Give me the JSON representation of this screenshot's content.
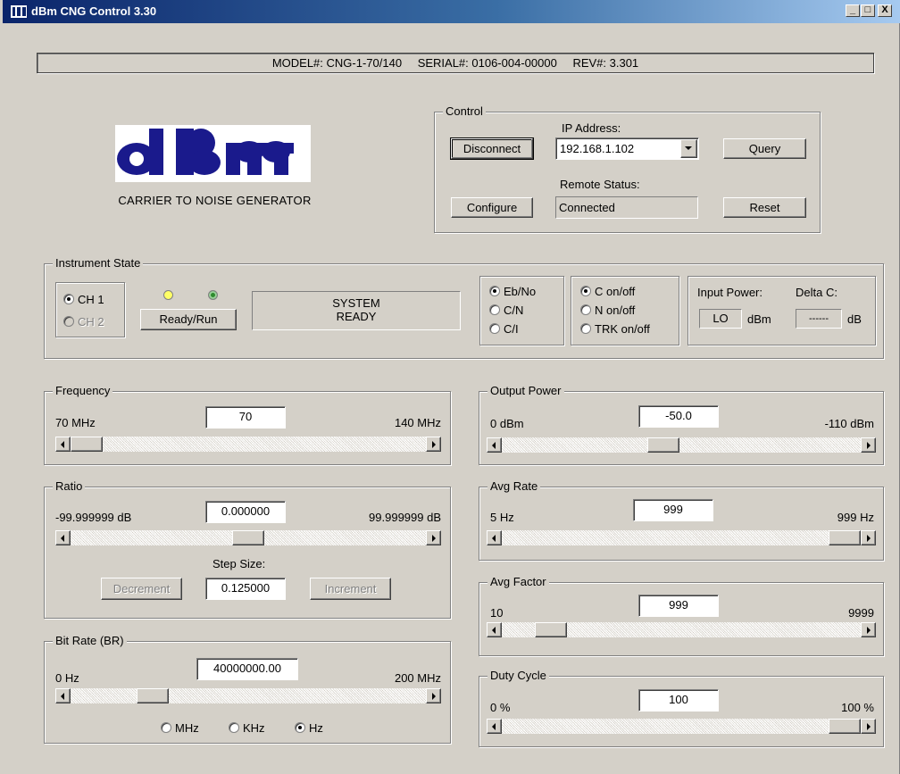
{
  "window": {
    "title": "dBm CNG Control 3.30",
    "minimize": "_",
    "maximize": "□",
    "close": "X"
  },
  "info_bar": {
    "model": "MODEL#: CNG-1-70/140",
    "serial": "SERIAL#: 0106-004-00000",
    "rev": "REV#: 3.301"
  },
  "logo": {
    "brand": "dBm",
    "caption": "CARRIER TO NOISE GENERATOR"
  },
  "control": {
    "legend": "Control",
    "ip_label": "IP Address:",
    "disconnect_label": "Disconnect",
    "ip_value": "192.168.1.102",
    "query_label": "Query",
    "remote_status_label": "Remote Status:",
    "configure_label": "Configure",
    "remote_status_value": "Connected",
    "reset_label": "Reset"
  },
  "instrument_state": {
    "legend": "Instrument State",
    "channels": [
      {
        "label": "CH 1",
        "selected": true,
        "enabled": true
      },
      {
        "label": "CH 2",
        "selected": false,
        "enabled": false
      }
    ],
    "ready_run_label": "Ready/Run",
    "status_line1": "SYSTEM",
    "status_line2": "READY",
    "ratio_modes": [
      {
        "label": "Eb/No",
        "selected": true
      },
      {
        "label": "C/N",
        "selected": false
      },
      {
        "label": "C/I",
        "selected": false
      }
    ],
    "toggles": [
      {
        "label": "C on/off",
        "selected": true
      },
      {
        "label": "N on/off",
        "selected": false
      },
      {
        "label": "TRK on/off",
        "selected": false
      }
    ],
    "input_power_label": "Input Power:",
    "input_power_value": "LO",
    "input_power_unit": "dBm",
    "delta_c_label": "Delta C:",
    "delta_c_value": "------",
    "delta_c_unit": "dB",
    "led_colors": {
      "yellow": "#ffff66",
      "green": "#2e8b2e"
    }
  },
  "frequency": {
    "legend": "Frequency",
    "min_label": "70 MHz",
    "value": "70",
    "max_label": "140 MHz",
    "position": 0.0
  },
  "ratio": {
    "legend": "Ratio",
    "min_label": "-99.999999 dB",
    "value": "0.000000",
    "max_label": "99.999999 dB",
    "position": 0.5,
    "step_size_label": "Step Size:",
    "step_value": "0.125000",
    "decrement_label": "Decrement",
    "increment_label": "Increment"
  },
  "bit_rate": {
    "legend": "Bit Rate (BR)",
    "min_label": "0 Hz",
    "value": "40000000.00",
    "max_label": "200 MHz",
    "position": 0.2,
    "units": [
      {
        "label": "MHz",
        "selected": false
      },
      {
        "label": "KHz",
        "selected": false
      },
      {
        "label": "Hz",
        "selected": true
      }
    ]
  },
  "output_power": {
    "legend": "Output Power",
    "min_label": "0 dBm",
    "value": "-50.0",
    "max_label": "-110 dBm",
    "position": 0.45
  },
  "avg_rate": {
    "legend": "Avg Rate",
    "min_label": "5 Hz",
    "value": "999",
    "max_label": "999 Hz",
    "position": 1.0
  },
  "avg_factor": {
    "legend": "Avg Factor",
    "min_label": "10",
    "value": "999",
    "max_label": "9999",
    "position": 0.1
  },
  "duty_cycle": {
    "legend": "Duty Cycle",
    "min_label": "0 %",
    "value": "100",
    "max_label": "100 %",
    "position": 1.0
  }
}
